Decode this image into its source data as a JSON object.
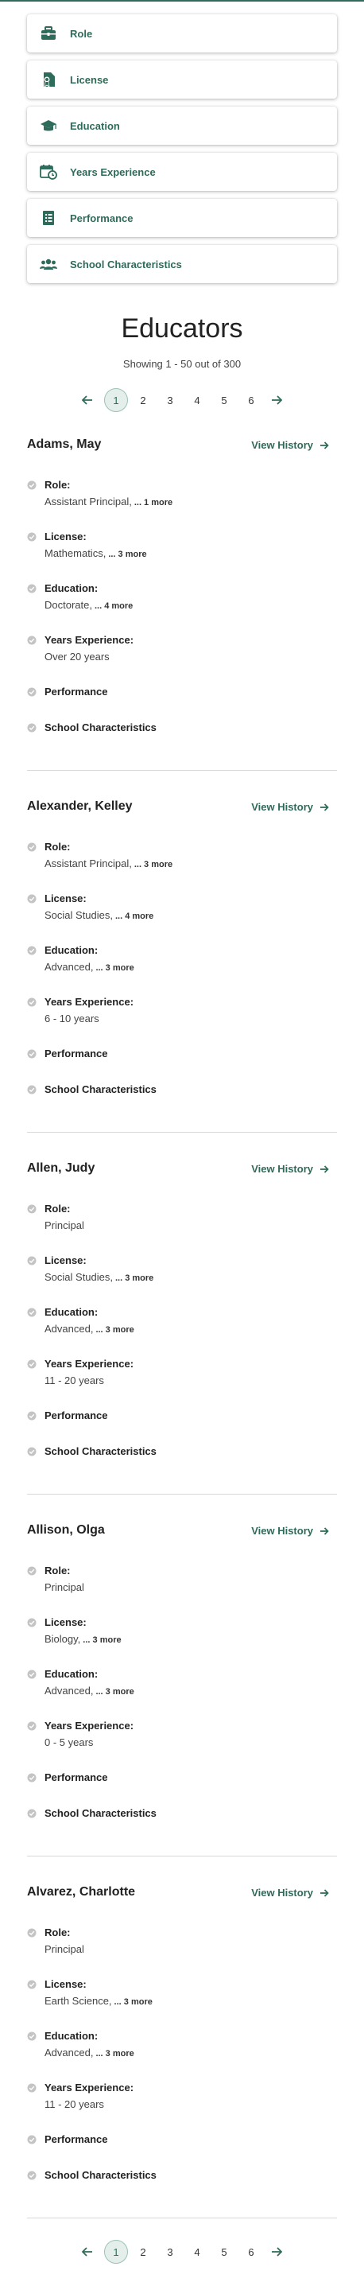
{
  "filters": [
    {
      "label": "Role",
      "icon": "briefcase-icon"
    },
    {
      "label": "License",
      "icon": "license-icon"
    },
    {
      "label": "Education",
      "icon": "graduation-cap-icon"
    },
    {
      "label": "Years Experience",
      "icon": "calendar-clock-icon"
    },
    {
      "label": "Performance",
      "icon": "report-icon"
    },
    {
      "label": "School Characteristics",
      "icon": "people-icon"
    }
  ],
  "heading": "Educators",
  "showing": "Showing 1 - 50 out of 300",
  "pagination": {
    "pages": [
      "1",
      "2",
      "3",
      "4",
      "5",
      "6"
    ],
    "current": "1"
  },
  "view_history_label": "View History",
  "attribute_labels": {
    "role": "Role:",
    "license": "License:",
    "education": "Education:",
    "years": "Years Experience:",
    "performance": "Performance",
    "school": "School Characteristics"
  },
  "educators": [
    {
      "name": "Adams, May",
      "role": {
        "value": "Assistant Principal,",
        "more": "... 1 more"
      },
      "license": {
        "value": "Mathematics,",
        "more": "... 3 more"
      },
      "education": {
        "value": "Doctorate,",
        "more": "... 4 more"
      },
      "years": {
        "value": "Over 20 years",
        "more": ""
      }
    },
    {
      "name": "Alexander, Kelley",
      "role": {
        "value": "Assistant Principal,",
        "more": "... 3 more"
      },
      "license": {
        "value": "Social Studies,",
        "more": "... 4 more"
      },
      "education": {
        "value": "Advanced,",
        "more": "... 3 more"
      },
      "years": {
        "value": "6 - 10 years",
        "more": ""
      }
    },
    {
      "name": "Allen, Judy",
      "role": {
        "value": "Principal",
        "more": ""
      },
      "license": {
        "value": "Social Studies,",
        "more": "... 3 more"
      },
      "education": {
        "value": "Advanced,",
        "more": "... 3 more"
      },
      "years": {
        "value": "11 - 20 years",
        "more": ""
      }
    },
    {
      "name": "Allison, Olga",
      "role": {
        "value": "Principal",
        "more": ""
      },
      "license": {
        "value": "Biology,",
        "more": "... 3 more"
      },
      "education": {
        "value": "Advanced,",
        "more": "... 3 more"
      },
      "years": {
        "value": "0 - 5 years",
        "more": ""
      }
    },
    {
      "name": "Alvarez, Charlotte",
      "role": {
        "value": "Principal",
        "more": ""
      },
      "license": {
        "value": "Earth Science,",
        "more": "... 3 more"
      },
      "education": {
        "value": "Advanced,",
        "more": "... 3 more"
      },
      "years": {
        "value": "11 - 20 years",
        "more": ""
      }
    }
  ],
  "colors": {
    "accent": "#2f6b5a",
    "active_page_bg": "#e4efeb",
    "check": "#c4c4c4",
    "divider": "#d8d8d8"
  }
}
